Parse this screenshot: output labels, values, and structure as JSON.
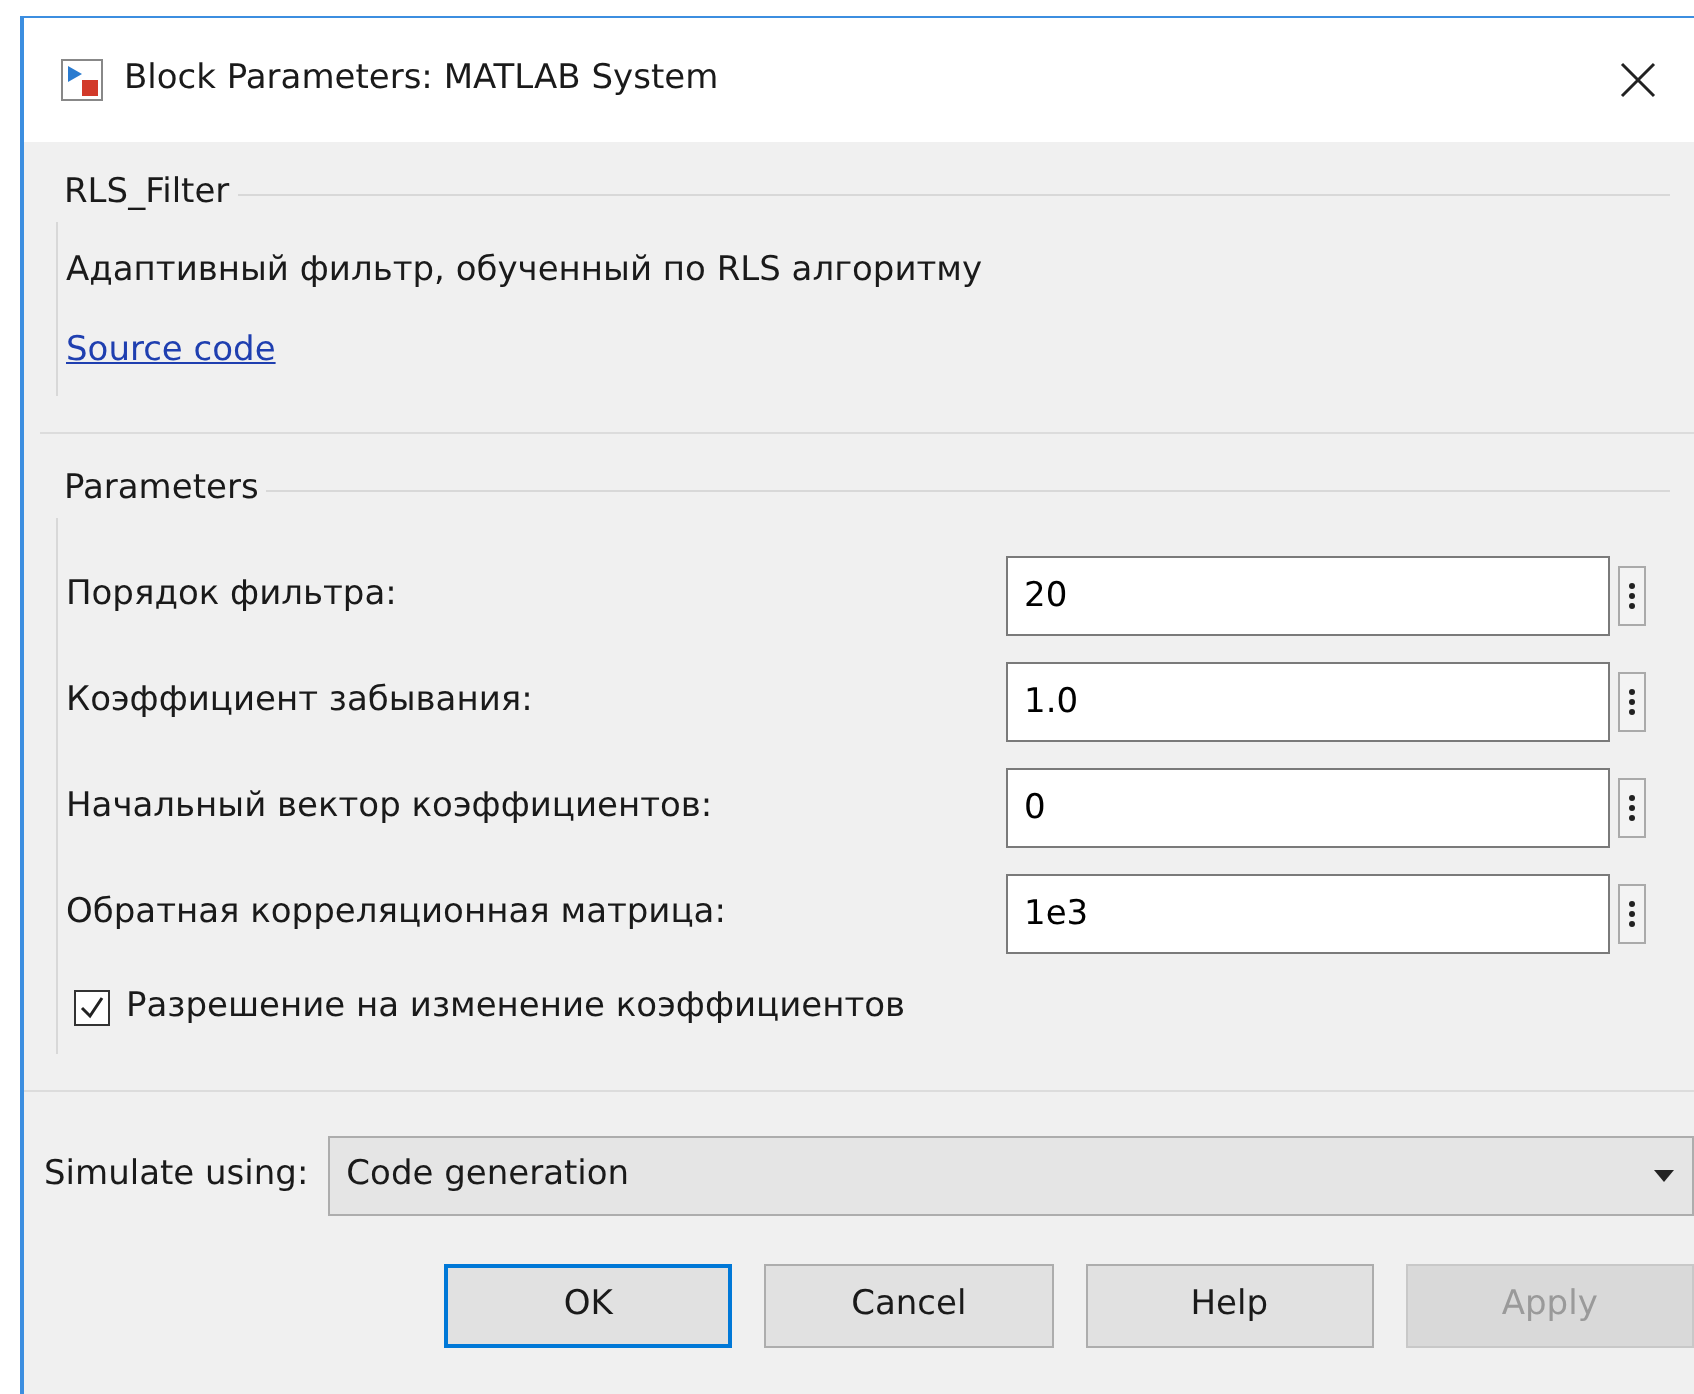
{
  "window": {
    "title": "Block Parameters: MATLAB System"
  },
  "description_group": {
    "title": "RLS_Filter",
    "text": "Адаптивный фильтр, обученный по RLS алгоритму",
    "link": "Source code"
  },
  "parameters_group": {
    "title": "Parameters",
    "fields": [
      {
        "label": "Порядок фильтра:",
        "value": "20"
      },
      {
        "label": "Коэффициент забывания:",
        "value": "1.0"
      },
      {
        "label": "Начальный вектор коэффициентов:",
        "value": "0"
      },
      {
        "label": "Обратная корреляционная матрица:",
        "value": "1e3"
      }
    ],
    "checkbox": {
      "label": "Разрешение на изменение коэффициентов",
      "checked": true
    }
  },
  "simulate": {
    "label": "Simulate using:",
    "value": "Code generation"
  },
  "buttons": [
    {
      "label": "OK",
      "default": true,
      "disabled": false
    },
    {
      "label": "Cancel",
      "default": false,
      "disabled": false
    },
    {
      "label": "Help",
      "default": false,
      "disabled": false
    },
    {
      "label": "Apply",
      "default": false,
      "disabled": true
    }
  ]
}
